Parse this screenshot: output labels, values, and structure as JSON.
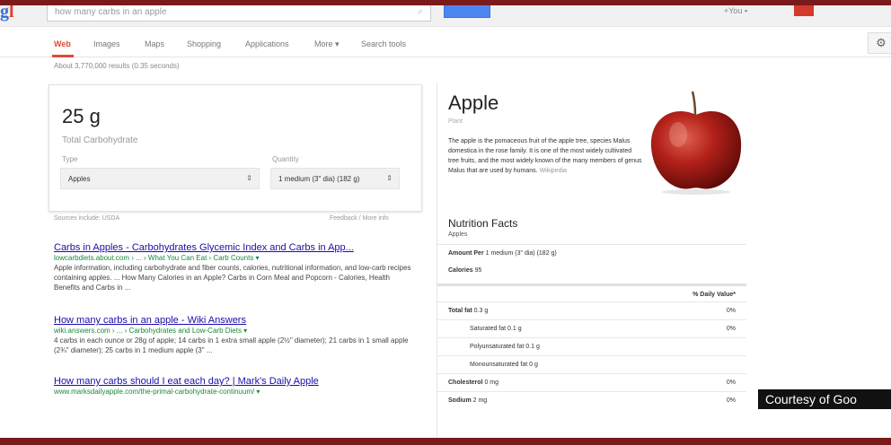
{
  "header": {
    "logo_part1": "g",
    "logo_part2": "l",
    "search_query": "how many carbs in an apple",
    "account_text": "+You  ▪",
    "search_icon": "magnifier-icon"
  },
  "tabs": [
    "Web",
    "Images",
    "Maps",
    "Shopping",
    "Applications",
    "More ▾",
    "Search tools"
  ],
  "results_count": "About 3,770,000 results (0.35 seconds)",
  "answer": {
    "value": "25 g",
    "label": "Total Carbohydrate",
    "type_label": "Type",
    "type_value": "Apples",
    "quantity_label": "Quantity",
    "quantity_value": "1 medium (3\" dia) (182 g)",
    "sources": "Sources include: USDA",
    "feedback": "Feedback / More info"
  },
  "results": [
    {
      "title": "Carbs in Apples - Carbohydrates Glycemic Index and Carbs in App...",
      "url": "lowcarbdiets.about.com › ... › What You Can Eat › Carb Counts ▾",
      "snippet": "Apple information, including carbohydrate and fiber counts, calories, nutritional information, and low-carb recipes containing apples. ... How Many Calories in an Apple? Carbs in Corn Meal and Popcorn - Calories, Health Benefits and Carbs in ..."
    },
    {
      "title": "How many carbs in an apple - Wiki Answers",
      "url": "wiki.answers.com › ... › Carbohydrates and Low-Carb Diets ▾",
      "snippet": "4 carbs in each ounce or 28g of apple; 14 carbs in 1 extra small apple (2½\" diameter); 21 carbs in 1 small apple (2¾\" diameter); 25 carbs in 1 medium apple (3\" ..."
    },
    {
      "title": "How many carbs should I eat each day? | Mark's Daily Apple",
      "url": "www.marksdailyapple.com/the-primal-carbohydrate-continuum/ ▾",
      "snippet": ""
    }
  ],
  "knowledge_panel": {
    "title": "Apple",
    "subtitle": "Plant",
    "description": "The apple is the pomaceous fruit of the apple tree, species Malus domestica in the rose family. It is one of the most widely cultivated tree fruits, and the most widely known of the many members of genus Malus that are used by humans.",
    "wiki_link": "Wikipedia",
    "nutrition_title": "Nutrition Facts",
    "nutrition_sub": "Apples",
    "amount_per_label": "Amount Per",
    "amount_per_value": "1 medium (3\" dia) (182 g)",
    "calories_label": "Calories",
    "calories_value": "95",
    "daily_value_header": "% Daily Value*",
    "rows": [
      {
        "label": "Total fat",
        "amount": "0.3 g",
        "pct": "0%",
        "bold": true,
        "indent": false
      },
      {
        "label": "Saturated fat",
        "amount": "0.1 g",
        "pct": "0%",
        "bold": false,
        "indent": true
      },
      {
        "label": "Polyunsaturated fat",
        "amount": "0.1 g",
        "pct": "",
        "bold": false,
        "indent": true
      },
      {
        "label": "Monounsaturated fat",
        "amount": "0 g",
        "pct": "",
        "bold": false,
        "indent": true
      },
      {
        "label": "Cholesterol",
        "amount": "0 mg",
        "pct": "0%",
        "bold": true,
        "indent": false
      },
      {
        "label": "Sodium",
        "amount": "2 mg",
        "pct": "0%",
        "bold": true,
        "indent": false
      }
    ]
  },
  "courtesy": "Courtesy of Goo",
  "colors": {
    "link": "#1a0dab",
    "url": "#1a8a3a",
    "active_tab": "#dd4b39",
    "frame": "#7a1a1a"
  }
}
